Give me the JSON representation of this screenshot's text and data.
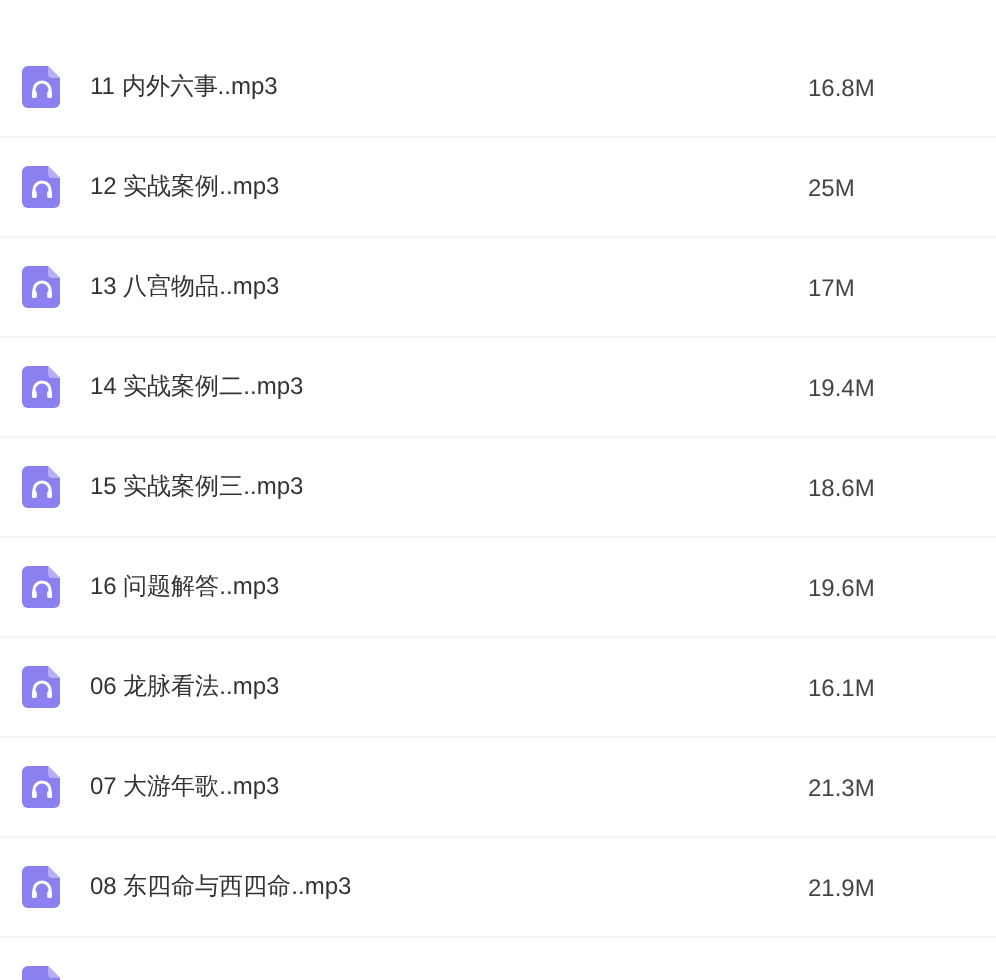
{
  "files": [
    {
      "name": "11 内外六事..mp3",
      "size": "16.8M"
    },
    {
      "name": "12 实战案例..mp3",
      "size": "25M"
    },
    {
      "name": "13 八宫物品..mp3",
      "size": "17M"
    },
    {
      "name": "14 实战案例二..mp3",
      "size": "19.4M"
    },
    {
      "name": "15 实战案例三..mp3",
      "size": "18.6M"
    },
    {
      "name": "16 问题解答..mp3",
      "size": "19.6M"
    },
    {
      "name": "06 龙脉看法..mp3",
      "size": "16.1M"
    },
    {
      "name": "07 大游年歌..mp3",
      "size": "21.3M"
    },
    {
      "name": "08 东四命与西四命..mp3",
      "size": "21.9M"
    }
  ]
}
